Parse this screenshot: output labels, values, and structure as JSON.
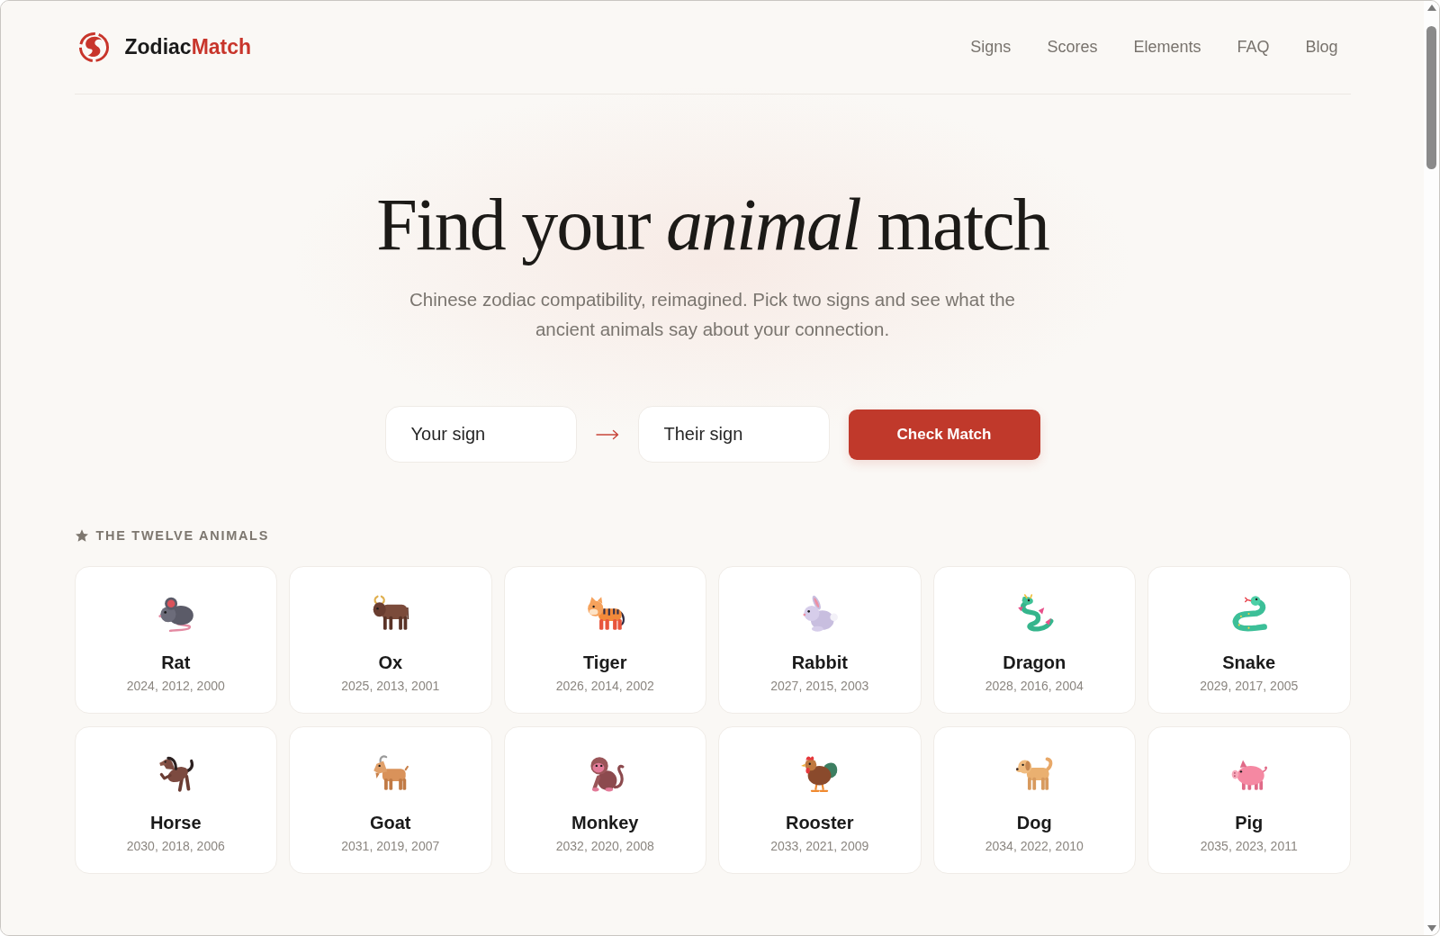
{
  "header": {
    "brand": {
      "name": "Zodiac",
      "accent": "Match"
    },
    "nav": [
      "Signs",
      "Scores",
      "Elements",
      "FAQ",
      "Blog"
    ]
  },
  "hero": {
    "title": "Find your *animal* match",
    "subtitle": "Chinese zodiac compatibility, reimagined. Pick two signs and see what the ancient animals say about your connection.",
    "your_sign": {
      "placeholder": "Your sign"
    },
    "their_sign": {
      "placeholder": "Their sign"
    },
    "button": "Check Match"
  },
  "animals": {
    "title": "THE TWELVE ANIMALS",
    "items": [
      {
        "kind": "rat",
        "name": "Rat",
        "years": "2024, 2012, 2000"
      },
      {
        "kind": "ox",
        "name": "Ox",
        "years": "2025, 2013, 2001"
      },
      {
        "kind": "tiger",
        "name": "Tiger",
        "years": "2026, 2014, 2002"
      },
      {
        "kind": "rabbit",
        "name": "Rabbit",
        "years": "2027, 2015, 2003"
      },
      {
        "kind": "dragon",
        "name": "Dragon",
        "years": "2028, 2016, 2004"
      },
      {
        "kind": "snake",
        "name": "Snake",
        "years": "2029, 2017, 2005"
      },
      {
        "kind": "horse",
        "name": "Horse",
        "years": "2030, 2018, 2006"
      },
      {
        "kind": "goat",
        "name": "Goat",
        "years": "2031, 2019, 2007"
      },
      {
        "kind": "monkey",
        "name": "Monkey",
        "years": "2032, 2020, 2008"
      },
      {
        "kind": "rooster",
        "name": "Rooster",
        "years": "2033, 2021, 2009"
      },
      {
        "kind": "dog",
        "name": "Dog",
        "years": "2034, 2022, 2010"
      },
      {
        "kind": "pig",
        "name": "Pig",
        "years": "2035, 2023, 2011"
      }
    ]
  }
}
